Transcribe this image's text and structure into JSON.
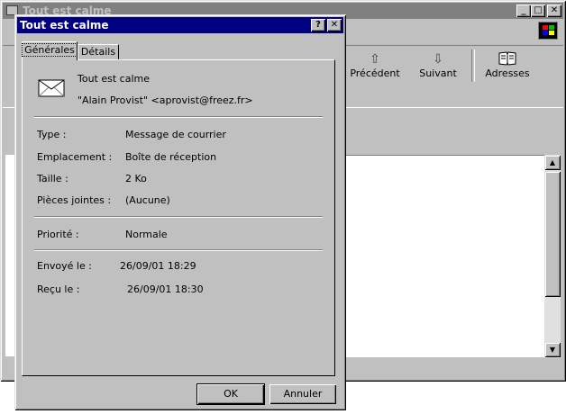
{
  "main_window": {
    "title": "Tout est calme",
    "controls": {
      "minimize": "_",
      "maximize": "□",
      "close": "✕"
    },
    "toolbar": {
      "items": [
        {
          "label": "Précédent",
          "icon": "up-arrow-icon"
        },
        {
          "label": "Suivant",
          "icon": "down-arrow-icon"
        },
        {
          "label": "Adresses",
          "icon": "address-book-icon"
        }
      ]
    }
  },
  "dialog": {
    "title": "Tout est calme",
    "help_glyph": "?",
    "close_glyph": "✕",
    "tabs": [
      {
        "label": "Générales",
        "active": true
      },
      {
        "label": "Détails",
        "active": false
      }
    ],
    "subject": "Tout est calme",
    "sender": "\"Alain Provist\" <aprovist@freez.fr>",
    "props": [
      {
        "label": "Type :",
        "value": "Message de courrier"
      },
      {
        "label": "Emplacement :",
        "value": "Boîte de réception"
      },
      {
        "label": "Taille :",
        "value": "2 Ko"
      },
      {
        "label": "Pièces jointes :",
        "value": "(Aucune)"
      }
    ],
    "priority": {
      "label": "Priorité :",
      "value": "Normale"
    },
    "sent": {
      "label": "Envoyé le :",
      "value": "26/09/01 18:29"
    },
    "received": {
      "label": "Reçu le :",
      "value": "26/09/01 18:30"
    },
    "buttons": {
      "ok": "OK",
      "cancel": "Annuler"
    }
  }
}
